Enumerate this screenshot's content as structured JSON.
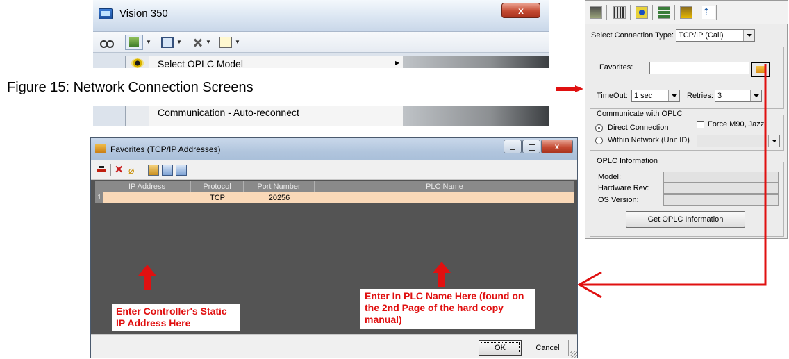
{
  "vision": {
    "title": "Vision 350",
    "close_glyph": "x",
    "menu": {
      "select_model": "Select OPLC Model",
      "auto_reconnect": "Communication - Auto-reconnect"
    },
    "icons": [
      "glasses-icon",
      "plc-hardware-icon",
      "monitor-icon",
      "tools-icon",
      "help-icon"
    ]
  },
  "caption": "Figure 15: Network Connection Screens",
  "connection": {
    "select_type_label": "Select Connection Type:",
    "select_type_value": "TCP/IP (Call)",
    "favorites_label": "Favorites:",
    "favorites_value": "",
    "timeout_label": "TimeOut:",
    "timeout_value": "1 sec",
    "retries_label": "Retries:",
    "retries_value": "3",
    "communicate_group": "Communicate with OPLC",
    "direct_connection": "Direct Connection",
    "within_network": "Within Network (Unit ID)",
    "force_m90": "Force M90, Jazz",
    "info_group": "OPLC Information",
    "model_label": "Model:",
    "hardware_label": "Hardware Rev:",
    "os_label": "OS Version:",
    "get_info_button": "Get OPLC Information",
    "direct_selected": true
  },
  "favorites_dialog": {
    "title": "Favorites (TCP/IP Addresses)",
    "close_glyph": "x",
    "columns": [
      "IP Address",
      "Protocol",
      "Port Number",
      "PLC Name"
    ],
    "row": {
      "index": "1",
      "ip": "",
      "protocol": "TCP",
      "port": "20256",
      "plc_name": ""
    },
    "annotation_ip": "Enter Controller's Static IP Address Here",
    "annotation_plc": "Enter In PLC Name Here (found on the 2nd Page of the hard copy manual)",
    "ok_button": "OK",
    "cancel_button": "Cancel"
  },
  "colors": {
    "annotation_red": "#e01010",
    "row_highlight": "#fad9b8",
    "grid_background": "#545454"
  }
}
